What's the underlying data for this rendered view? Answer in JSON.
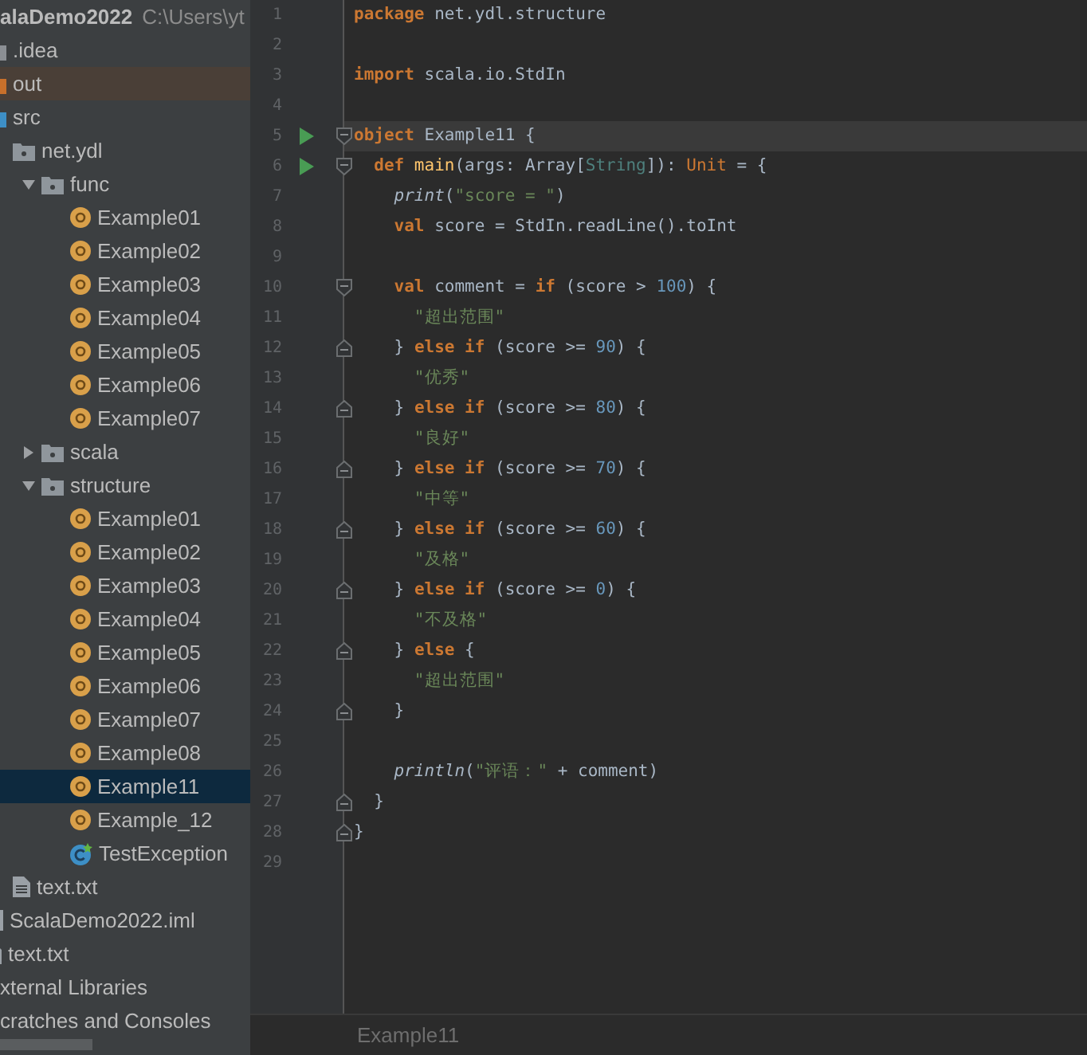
{
  "project_tree": [
    {
      "label": "alaDemo2022",
      "path": "C:\\Users\\yt",
      "kind": "project",
      "selected": false,
      "excluded": false,
      "children": [
        {
          "label": ".idea",
          "kind": "folder",
          "color": "#8b8f94",
          "selected": false,
          "excluded": false
        },
        {
          "label": "out",
          "kind": "folder",
          "color": "#c8702b",
          "selected": false,
          "excluded": true
        },
        {
          "label": "src",
          "kind": "folder",
          "color": "#3d8fc6",
          "selected": false,
          "excluded": false,
          "children": [
            {
              "label": "net.ydl",
              "kind": "package",
              "selected": false,
              "excluded": false,
              "children": [
                {
                  "label": "func",
                  "kind": "package",
                  "expanded": true,
                  "selected": false,
                  "excluded": false,
                  "children": [
                    {
                      "label": "Example01",
                      "kind": "object",
                      "selected": false,
                      "excluded": false
                    },
                    {
                      "label": "Example02",
                      "kind": "object",
                      "selected": false,
                      "excluded": false
                    },
                    {
                      "label": "Example03",
                      "kind": "object",
                      "selected": false,
                      "excluded": false
                    },
                    {
                      "label": "Example04",
                      "kind": "object",
                      "selected": false,
                      "excluded": false
                    },
                    {
                      "label": "Example05",
                      "kind": "object",
                      "selected": false,
                      "excluded": false
                    },
                    {
                      "label": "Example06",
                      "kind": "object",
                      "selected": false,
                      "excluded": false
                    },
                    {
                      "label": "Example07",
                      "kind": "object",
                      "selected": false,
                      "excluded": false
                    }
                  ]
                },
                {
                  "label": "scala",
                  "kind": "package",
                  "expanded": false,
                  "selected": false,
                  "excluded": false
                },
                {
                  "label": "structure",
                  "kind": "package",
                  "expanded": true,
                  "selected": false,
                  "excluded": false,
                  "children": [
                    {
                      "label": "Example01",
                      "kind": "object",
                      "selected": false,
                      "excluded": false
                    },
                    {
                      "label": "Example02",
                      "kind": "object",
                      "selected": false,
                      "excluded": false
                    },
                    {
                      "label": "Example03",
                      "kind": "object",
                      "selected": false,
                      "excluded": false
                    },
                    {
                      "label": "Example04",
                      "kind": "object",
                      "selected": false,
                      "excluded": false
                    },
                    {
                      "label": "Example05",
                      "kind": "object",
                      "selected": false,
                      "excluded": false
                    },
                    {
                      "label": "Example06",
                      "kind": "object",
                      "selected": false,
                      "excluded": false
                    },
                    {
                      "label": "Example07",
                      "kind": "object",
                      "selected": false,
                      "excluded": false
                    },
                    {
                      "label": "Example08",
                      "kind": "object",
                      "selected": false,
                      "excluded": false
                    },
                    {
                      "label": "Example11",
                      "kind": "object",
                      "selected": true,
                      "excluded": false
                    },
                    {
                      "label": "Example_12",
                      "kind": "object",
                      "selected": false,
                      "excluded": false
                    },
                    {
                      "label": "TestException",
                      "kind": "class",
                      "selected": false,
                      "excluded": false
                    }
                  ]
                }
              ]
            },
            {
              "label": "text.txt",
              "kind": "text-file",
              "selected": false,
              "excluded": false
            }
          ]
        },
        {
          "label": "ScalaDemo2022.iml",
          "kind": "module-file",
          "selected": false,
          "excluded": false
        },
        {
          "label": "text.txt",
          "kind": "text-file",
          "selected": false,
          "excluded": false
        }
      ]
    },
    {
      "label": "xternal Libraries",
      "kind": "node",
      "selected": false,
      "excluded": false
    },
    {
      "label": "cratches and Consoles",
      "kind": "node",
      "selected": false,
      "excluded": false
    }
  ],
  "editor": {
    "lines": [
      {
        "number": "1",
        "run": false,
        "current": false,
        "tokens": [
          {
            "kind": "keyword",
            "text": "package"
          },
          {
            "kind": "plain",
            "text": " net.ydl.structure"
          }
        ]
      },
      {
        "number": "2",
        "run": false,
        "current": false
      },
      {
        "number": "3",
        "run": false,
        "current": false,
        "tokens": [
          {
            "kind": "keyword",
            "text": "import"
          },
          {
            "kind": "plain",
            "text": " scala.io.StdIn"
          }
        ]
      },
      {
        "number": "4",
        "run": false,
        "current": false
      },
      {
        "number": "5",
        "run": true,
        "current": true,
        "fold_marker": {
          "kind": "open"
        },
        "tokens": [
          {
            "kind": "keyword",
            "text": "object"
          },
          {
            "kind": "plain",
            "text": " Example11 {"
          }
        ]
      },
      {
        "number": "6",
        "run": true,
        "current": false,
        "fold_marker": {
          "kind": "open"
        },
        "tokens": [
          {
            "kind": "keyword",
            "text": "  def"
          },
          {
            "kind": "decl",
            "text": " main"
          },
          {
            "kind": "plain",
            "text": "(args: Array["
          },
          {
            "kind": "type",
            "text": "String"
          },
          {
            "kind": "plain",
            "text": "]): "
          },
          {
            "kind": "unit",
            "text": "Unit"
          },
          {
            "kind": "plain",
            "text": " = {"
          }
        ]
      },
      {
        "number": "7",
        "run": false,
        "current": false,
        "tokens": [
          {
            "kind": "call",
            "text": "    print"
          },
          {
            "kind": "plain",
            "text": "("
          },
          {
            "kind": "string",
            "text": "\"score = \""
          },
          {
            "kind": "plain",
            "text": ")"
          }
        ]
      },
      {
        "number": "8",
        "run": false,
        "current": false,
        "tokens": [
          {
            "kind": "keyword",
            "text": "    val"
          },
          {
            "kind": "plain",
            "text": " score = StdIn.readLine().toInt"
          }
        ]
      },
      {
        "number": "9",
        "run": false,
        "current": false
      },
      {
        "number": "10",
        "run": false,
        "current": false,
        "fold_marker": {
          "kind": "open"
        },
        "tokens": [
          {
            "kind": "keyword",
            "text": "    val"
          },
          {
            "kind": "plain",
            "text": " comment = "
          },
          {
            "kind": "keyword",
            "text": "if"
          },
          {
            "kind": "plain",
            "text": " (score > "
          },
          {
            "kind": "number",
            "text": "100"
          },
          {
            "kind": "plain",
            "text": ") {"
          }
        ]
      },
      {
        "number": "11",
        "run": false,
        "current": false,
        "tokens": [
          {
            "kind": "string",
            "text": "      \"超出范围\""
          }
        ]
      },
      {
        "number": "12",
        "run": false,
        "current": false,
        "fold_marker": {
          "kind": "close"
        },
        "tokens": [
          {
            "kind": "plain",
            "text": "    } "
          },
          {
            "kind": "keyword",
            "text": "else if"
          },
          {
            "kind": "plain",
            "text": " (score >= "
          },
          {
            "kind": "number",
            "text": "90"
          },
          {
            "kind": "plain",
            "text": ") {"
          }
        ]
      },
      {
        "number": "13",
        "run": false,
        "current": false,
        "tokens": [
          {
            "kind": "string",
            "text": "      \"优秀\""
          }
        ]
      },
      {
        "number": "14",
        "run": false,
        "current": false,
        "fold_marker": {
          "kind": "close"
        },
        "tokens": [
          {
            "kind": "plain",
            "text": "    } "
          },
          {
            "kind": "keyword",
            "text": "else if"
          },
          {
            "kind": "plain",
            "text": " (score >= "
          },
          {
            "kind": "number",
            "text": "80"
          },
          {
            "kind": "plain",
            "text": ") {"
          }
        ]
      },
      {
        "number": "15",
        "run": false,
        "current": false,
        "tokens": [
          {
            "kind": "string",
            "text": "      \"良好\""
          }
        ]
      },
      {
        "number": "16",
        "run": false,
        "current": false,
        "fold_marker": {
          "kind": "close"
        },
        "tokens": [
          {
            "kind": "plain",
            "text": "    } "
          },
          {
            "kind": "keyword",
            "text": "else if"
          },
          {
            "kind": "plain",
            "text": " (score >= "
          },
          {
            "kind": "number",
            "text": "70"
          },
          {
            "kind": "plain",
            "text": ") {"
          }
        ]
      },
      {
        "number": "17",
        "run": false,
        "current": false,
        "tokens": [
          {
            "kind": "string",
            "text": "      \"中等\""
          }
        ]
      },
      {
        "number": "18",
        "run": false,
        "current": false,
        "fold_marker": {
          "kind": "close"
        },
        "tokens": [
          {
            "kind": "plain",
            "text": "    } "
          },
          {
            "kind": "keyword",
            "text": "else if"
          },
          {
            "kind": "plain",
            "text": " (score >= "
          },
          {
            "kind": "number",
            "text": "60"
          },
          {
            "kind": "plain",
            "text": ") {"
          }
        ]
      },
      {
        "number": "19",
        "run": false,
        "current": false,
        "tokens": [
          {
            "kind": "string",
            "text": "      \"及格\""
          }
        ]
      },
      {
        "number": "20",
        "run": false,
        "current": false,
        "fold_marker": {
          "kind": "close"
        },
        "tokens": [
          {
            "kind": "plain",
            "text": "    } "
          },
          {
            "kind": "keyword",
            "text": "else if"
          },
          {
            "kind": "plain",
            "text": " (score >= "
          },
          {
            "kind": "number",
            "text": "0"
          },
          {
            "kind": "plain",
            "text": ") {"
          }
        ]
      },
      {
        "number": "21",
        "run": false,
        "current": false,
        "tokens": [
          {
            "kind": "string",
            "text": "      \"不及格\""
          }
        ]
      },
      {
        "number": "22",
        "run": false,
        "current": false,
        "fold_marker": {
          "kind": "close"
        },
        "tokens": [
          {
            "kind": "plain",
            "text": "    } "
          },
          {
            "kind": "keyword",
            "text": "else"
          },
          {
            "kind": "plain",
            "text": " {"
          }
        ]
      },
      {
        "number": "23",
        "run": false,
        "current": false,
        "tokens": [
          {
            "kind": "string",
            "text": "      \"超出范围\""
          }
        ]
      },
      {
        "number": "24",
        "run": false,
        "current": false,
        "fold_marker": {
          "kind": "close"
        },
        "tokens": [
          {
            "kind": "plain",
            "text": "    }"
          }
        ]
      },
      {
        "number": "25",
        "run": false,
        "current": false
      },
      {
        "number": "26",
        "run": false,
        "current": false,
        "tokens": [
          {
            "kind": "call",
            "text": "    println"
          },
          {
            "kind": "plain",
            "text": "("
          },
          {
            "kind": "string",
            "text": "\"评语：\""
          },
          {
            "kind": "plain",
            "text": " + comment)"
          }
        ]
      },
      {
        "number": "27",
        "run": false,
        "current": false,
        "fold_marker": {
          "kind": "close"
        },
        "tokens": [
          {
            "kind": "plain",
            "text": "  }"
          }
        ]
      },
      {
        "number": "28",
        "run": false,
        "current": false,
        "fold_marker": {
          "kind": "close"
        },
        "tokens": [
          {
            "kind": "plain",
            "text": "}"
          }
        ]
      },
      {
        "number": "29",
        "run": false,
        "current": false
      }
    ],
    "breadcrumb": "Example11"
  }
}
